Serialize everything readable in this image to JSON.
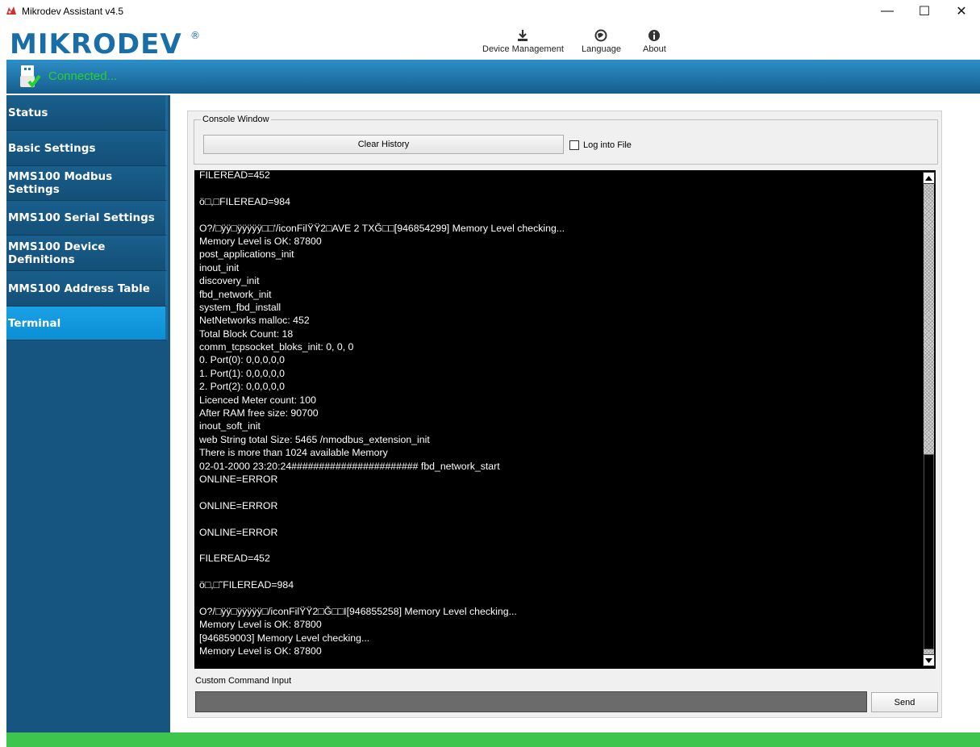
{
  "window": {
    "title": "Mikrodev Assistant v4.5",
    "icons": {
      "app": "mikrodev-app-icon",
      "minimize": "minimize-icon",
      "maximize": "maximize-icon",
      "close": "close-icon"
    },
    "minimize_glyph": "—",
    "maximize_glyph": "☐",
    "close_glyph": "✕"
  },
  "header": {
    "logo_text": "MIKRODEV",
    "logo_mark": "®",
    "toolbar": [
      {
        "label": "Device Management",
        "icon": "download-icon"
      },
      {
        "label": "Language",
        "icon": "globe-icon"
      },
      {
        "label": "About",
        "icon": "info-icon"
      }
    ]
  },
  "status": {
    "text": "Connected...",
    "icon": "usb-connected-icon",
    "color": "#2ad12a"
  },
  "sidebar": {
    "items": [
      {
        "label": "Status",
        "active": false
      },
      {
        "label": "Basic Settings",
        "active": false
      },
      {
        "label": "MMS100 Modbus Settings",
        "active": false
      },
      {
        "label": "MMS100 Serial Settings",
        "active": false
      },
      {
        "label": "MMS100 Device Definitions",
        "active": false
      },
      {
        "label": "MMS100 Address Table",
        "active": false
      },
      {
        "label": "Terminal",
        "active": true
      }
    ]
  },
  "console_panel": {
    "group_label": "Console Window",
    "clear_button": "Clear History",
    "log_checkbox_label": "Log into File",
    "log_checked": false,
    "lines": [
      "FILEREAD=452",
      "",
      "ö□,□FILEREAD=984",
      "",
      "O?/□ÿÿ□ÿÿÿÿÿ□□'/iconFilŸŸ2□AVE 2 TXĞ□□[946854299] Memory Level checking...",
      "Memory Level is OK: 87800",
      "post_applications_init",
      "inout_init",
      "discovery_init",
      "fbd_network_init",
      "system_fbd_install",
      "NetNetworks malloc: 452",
      "Total Block Count: 18",
      "comm_tcpsocket_bloks_init: 0, 0, 0",
      "0. Port(0): 0,0,0,0,0",
      "1. Port(1): 0,0,0,0,0",
      "2. Port(2): 0,0,0,0,0",
      "Licenced Meter count: 100",
      "After RAM free size: 90700",
      "inout_soft_init",
      "web String total Size: 5465 /nmodbus_extension_init",
      "There is more than 1024 available Memory",
      "02-01-2000 23:20:24####################### fbd_network_start",
      "ONLINE=ERROR",
      "",
      "ONLINE=ERROR",
      "",
      "ONLINE=ERROR",
      "",
      "FILEREAD=452",
      "",
      "ö□,□˜FILEREAD=984",
      "",
      "O?/□ÿÿ□ÿÿÿÿÿ□/iconFilŸŸ2□Ğ□□I[946855258] Memory Level checking...",
      "Memory Level is OK: 87800",
      "[946859003] Memory Level checking...",
      "Memory Level is OK: 87800"
    ]
  },
  "command": {
    "label": "Custom Command Input",
    "value": "",
    "send_button": "Send"
  },
  "colors": {
    "status_bar": "#1f7ab3",
    "sidebar_bg": "#15557f",
    "sidebar_active": "#1aa1e6",
    "console_bg": "#000000",
    "footer": "#3ec54e"
  }
}
